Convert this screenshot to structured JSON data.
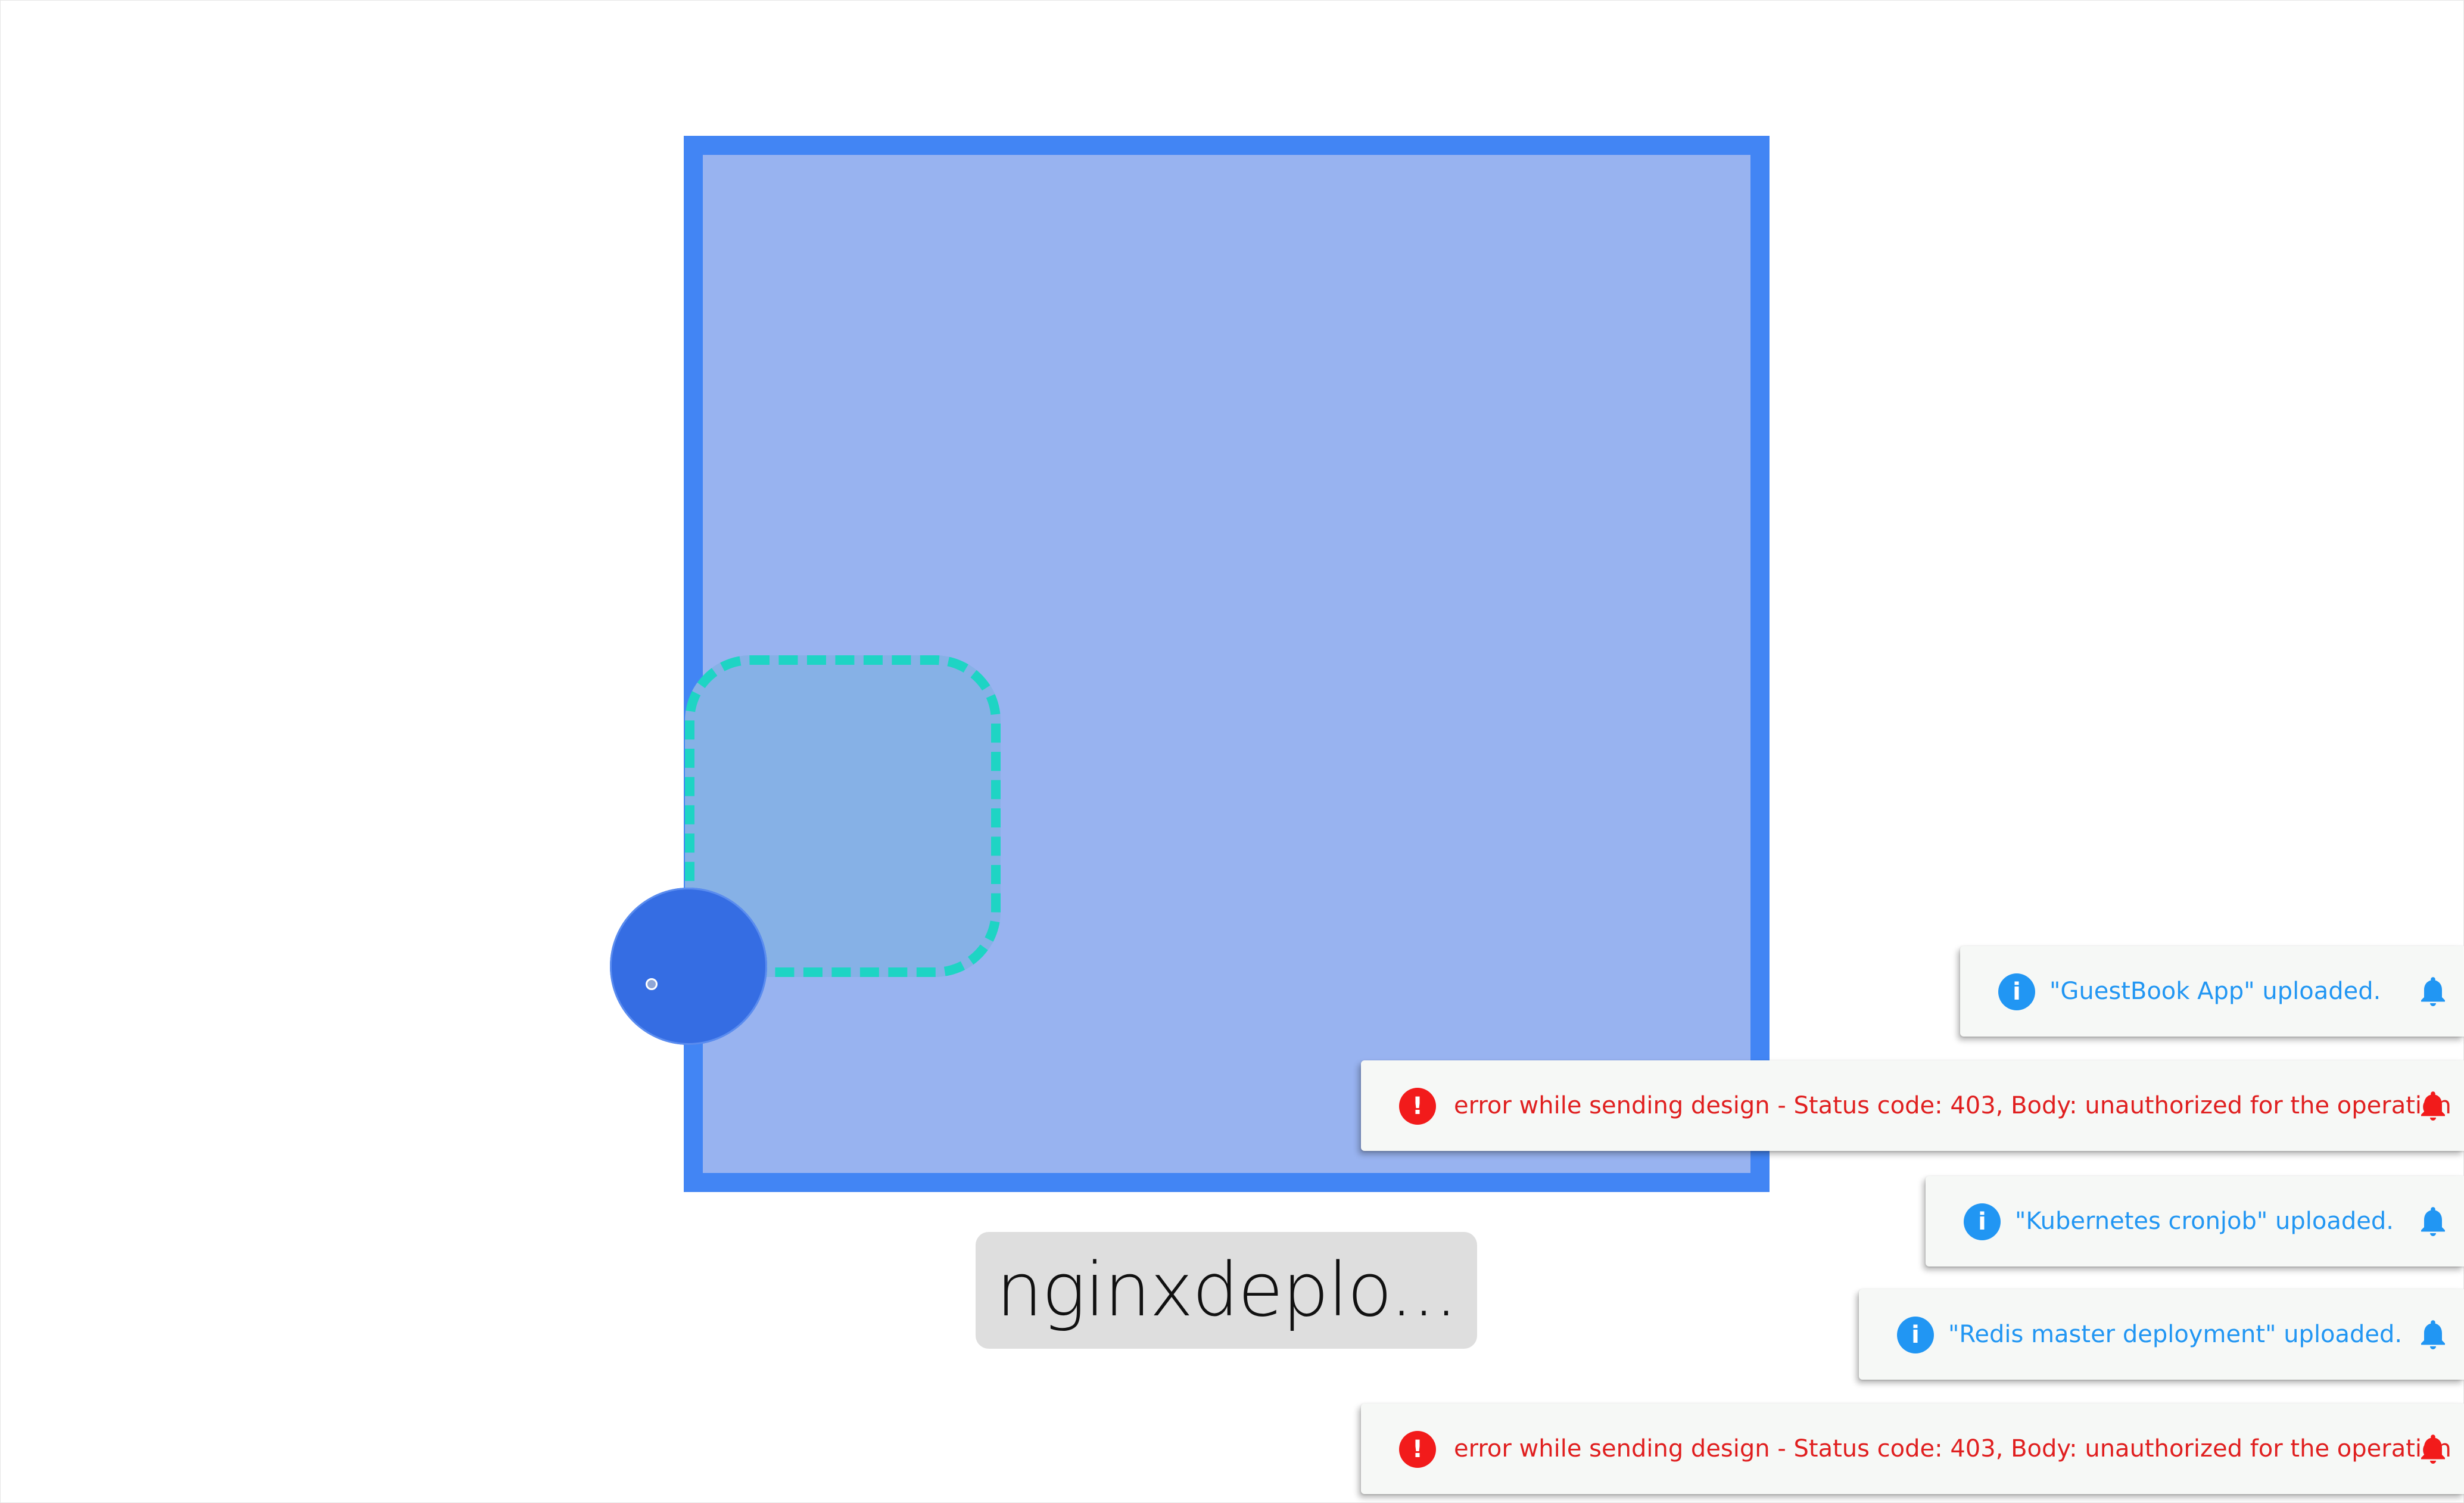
{
  "canvas": {
    "node": {
      "name": "nginxdeplo...",
      "fill_color": "#98b3f0",
      "border_color": "#4285f4",
      "inner_node_border_color": "#1ed4c4",
      "handle_color": "#356de3"
    }
  },
  "notifications": [
    {
      "type": "info",
      "icon": "info-icon",
      "message": "\"GuestBook App\" uploaded.",
      "color": "#2196f3"
    },
    {
      "type": "error",
      "icon": "error-icon",
      "message": "error while sending design - Status code: 403, Body: unauthorized for the operation",
      "color": "#f21b1b"
    },
    {
      "type": "info",
      "icon": "info-icon",
      "message": "\"Kubernetes cronjob\" uploaded.",
      "color": "#2196f3"
    },
    {
      "type": "info",
      "icon": "info-icon",
      "message": "\"Redis master deployment\" uploaded.",
      "color": "#2196f3"
    },
    {
      "type": "error",
      "icon": "error-icon",
      "message": "error while sending design - Status code: 403, Body: unauthorized for the operation",
      "color": "#f21b1b"
    }
  ],
  "icons": {
    "info_glyph": "i",
    "error_glyph": "!"
  }
}
